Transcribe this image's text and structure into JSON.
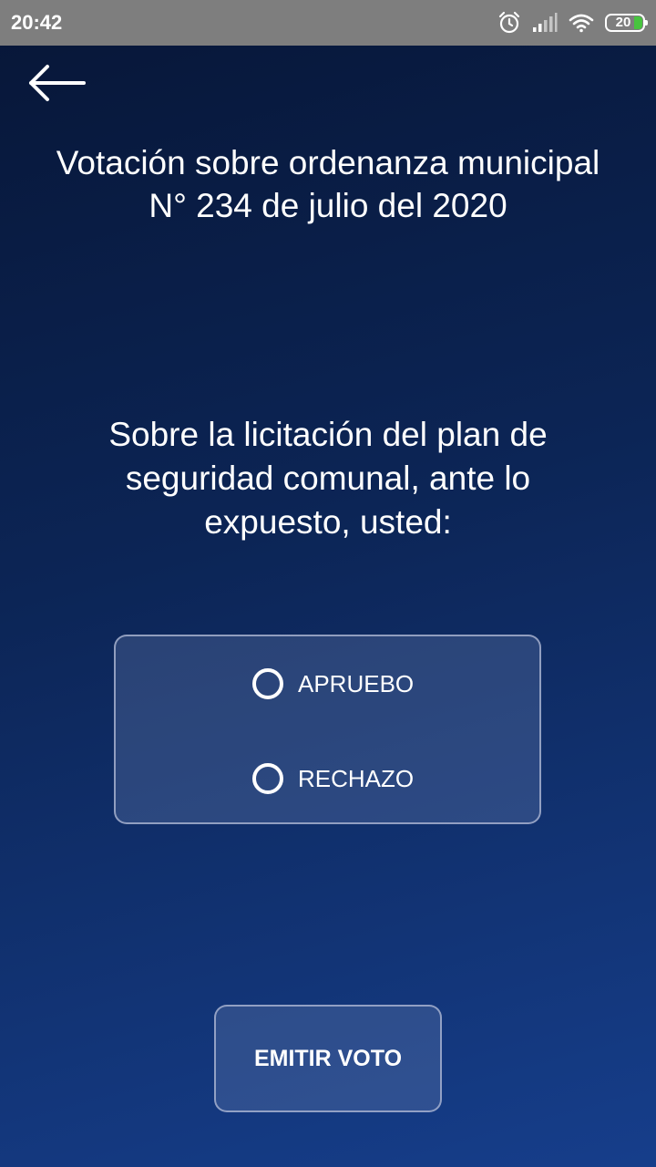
{
  "status_bar": {
    "time": "20:42",
    "battery_level": "20",
    "icons": [
      "alarm-icon",
      "signal-icon",
      "wifi-icon",
      "battery-icon"
    ],
    "battery_color": "#48c43f"
  },
  "header": {
    "back_icon": "arrow-left-icon",
    "title": "Votación sobre ordenanza municipal N° 234 de julio del 2020"
  },
  "question": {
    "text": "Sobre la licitación del plan de seguridad comunal, ante lo expuesto, usted:"
  },
  "options": [
    {
      "label": "APRUEBO",
      "selected": false
    },
    {
      "label": "RECHAZO",
      "selected": false
    }
  ],
  "submit": {
    "label": "EMITIR VOTO"
  },
  "colors": {
    "background_top": "#071637",
    "background_bottom": "#163e8b",
    "status_bar": "#7e7e7e",
    "text": "#ffffff"
  }
}
